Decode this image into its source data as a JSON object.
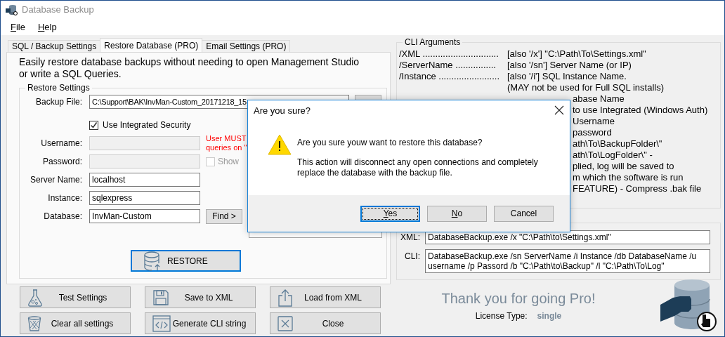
{
  "window": {
    "title": "Database Backup"
  },
  "menu": [
    {
      "label": "File",
      "underlined_key": true
    },
    {
      "label": "Help",
      "underlined_key": true
    }
  ],
  "tabs": [
    {
      "label": "SQL / Backup Settings",
      "selected": false
    },
    {
      "label": "Restore Database (PRO)",
      "selected": true
    },
    {
      "label": "Email Settings (PRO)",
      "selected": false
    }
  ],
  "intro": "Easily restore database backups without needing to open Management Studio\nor write a SQL Queries.",
  "restore_settings": {
    "title": "Restore Settings",
    "backup_file": {
      "label": "Backup File:",
      "value": "C:\\Support\\BAK\\InvMan-Custom_20171218_15"
    },
    "integrated_security": {
      "label": "Use Integrated Security",
      "checked": true
    },
    "fields": [
      {
        "label": "Username:",
        "disabled": true,
        "note": "User MUST\nqueries on \""
      },
      {
        "label": "Password:",
        "disabled": true,
        "checkbox": {
          "label": "Show",
          "checked": false,
          "disabled": true
        }
      },
      {
        "label": "Server Name:",
        "value": "localhost",
        "disabled": false
      },
      {
        "label": "Instance:",
        "value": "sqlexpress",
        "disabled": false
      },
      {
        "label": "Database:",
        "value": "InvMan-Custom",
        "disabled": false,
        "button": "Find >"
      }
    ],
    "restore_button": "RESTORE"
  },
  "buttons": [
    {
      "label": "Test Settings"
    },
    {
      "label": "Save to XML"
    },
    {
      "label": "Load from XML"
    },
    {
      "label": "Clear all settings"
    },
    {
      "label": "Generate CLI string"
    },
    {
      "label": "Close"
    }
  ],
  "cli_arguments": {
    "title": "CLI Arguments",
    "rows": [
      {
        "arg": "/XML ..............................",
        "desc": "[also '/x'] \"C:\\Path\\To\\Settings.xml\""
      },
      {
        "arg": "/ServerName ................",
        "desc": "[also '/sn'] Server Name (or IP)"
      },
      {
        "arg": "/Instance ........................",
        "desc": "[also '/i'] SQL Instance Name."
      },
      {
        "desc": "(MAY not be used for Full SQL installs)"
      }
    ],
    "covered_rows": [
      "abase Name",
      "to use Integrated (Windows Auth)",
      "Username",
      "password",
      "ath\\To\\BackupFolder\\\"",
      "ath\\To\\LogFolder\\\" -",
      "plied, log will be saved to",
      "m which the software is run",
      "FEATURE) - Compress .bak file"
    ]
  },
  "command_lines": [
    {
      "label": "XML:",
      "value": "DatabaseBackup.exe /x \"C:\\Path\\to\\Settings.xml\""
    },
    {
      "label": "CLI:",
      "value": "DatabaseBackup.exe /sn ServerName /i Instance /db DatabaseName /u username /p Passord /b \"C:\\Path\\to\\Backup\" /l \"C:\\Path\\To\\Log\""
    }
  ],
  "thanks": {
    "headline": "Thank you for going Pro!",
    "license_label": "License Type:",
    "license_value": "single"
  },
  "dialog": {
    "title": "Are you sure?",
    "message": "Are you sure youw want to restore this database?",
    "detail": "This action will disconnect any open connections and completely\nreplace the database with the backup file.",
    "buttons": [
      {
        "label": "Yes",
        "underlined_key": true,
        "focused": true
      },
      {
        "label": "No",
        "underlined_key": true,
        "focused": false
      },
      {
        "label": "Cancel",
        "underlined_key": false,
        "focused": false
      }
    ]
  }
}
